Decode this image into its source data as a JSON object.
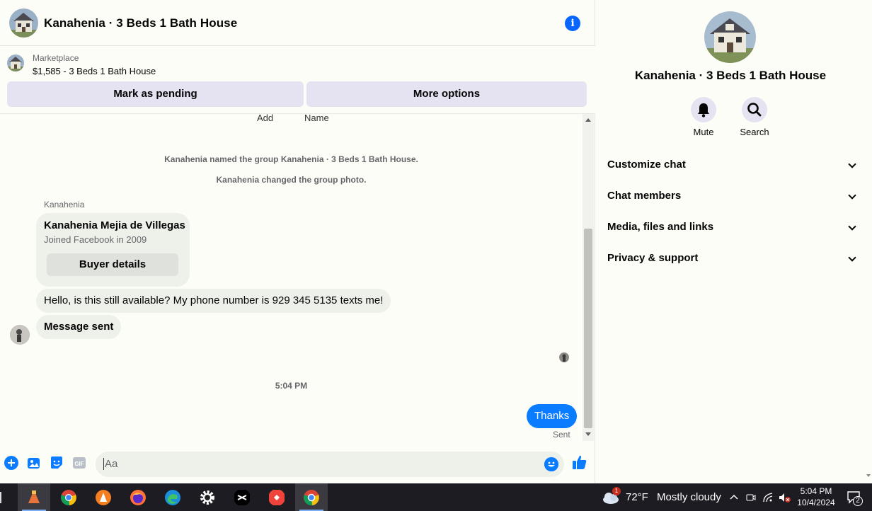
{
  "header": {
    "title": "Kanahenia · 3 Beds 1 Bath House",
    "info_glyph": "i"
  },
  "marketplace": {
    "label": "Marketplace",
    "listing": "$1,585 - 3 Beds 1 Bath House",
    "mark_pending": "Mark as pending",
    "more_options": "More options"
  },
  "chat": {
    "top_chips": [
      "Add",
      "Name"
    ],
    "system": [
      "Kanahenia named the group Kanahenia · 3 Beds 1 Bath House.",
      "Kanahenia changed the group photo."
    ],
    "sender": "Kanahenia",
    "buyer_card": {
      "name": "Kanahenia Mejia de Villegas",
      "sub": "Joined Facebook in 2009",
      "button": "Buyer details"
    },
    "incoming": [
      "Hello, is this still available? My phone number is 929 345 5135 texts me!",
      "Message sent"
    ],
    "time": "5:04 PM",
    "outgoing": "Thanks",
    "status": "Sent"
  },
  "composer": {
    "placeholder": "Aa",
    "icons": [
      "plus-icon",
      "photo-icon",
      "sticker-icon",
      "gif-icon",
      "emoji-icon",
      "thumbs-up-icon"
    ],
    "gif_label": "GIF"
  },
  "info_panel": {
    "title": "Kanahenia · 3 Beds 1 Bath House",
    "actions": [
      "Mute",
      "Search"
    ],
    "sections": [
      "Customize chat",
      "Chat members",
      "Media, files and links",
      "Privacy & support"
    ]
  },
  "taskbar": {
    "weather_badge": "1",
    "temp": "72°F",
    "condition": "Mostly cloudy",
    "time": "5:04 PM",
    "date": "10/4/2024",
    "notifications": "2"
  },
  "colors": {
    "accent": "#0a7cff",
    "info_blue": "#0866ff",
    "button_bg": "#e5e2f1",
    "bubble_in": "#eef0ea",
    "taskbar": "#1c1c22"
  }
}
